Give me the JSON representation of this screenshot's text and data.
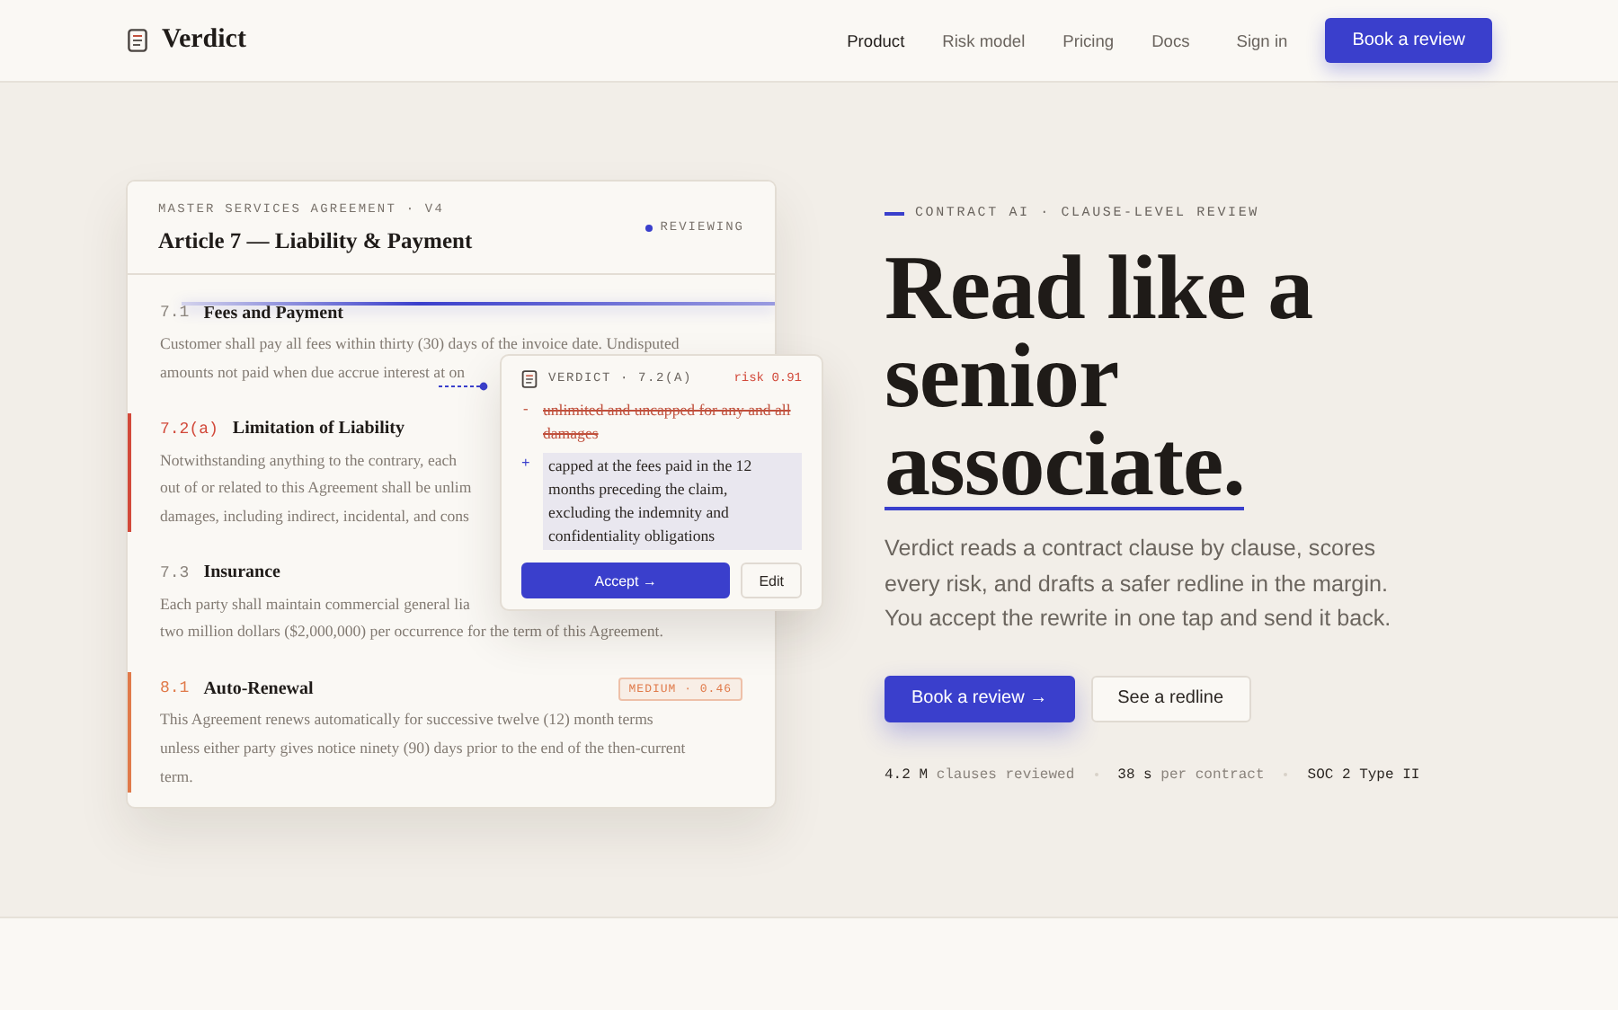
{
  "header": {
    "brand": "Verdict",
    "nav": [
      {
        "label": "Product",
        "selected": true
      },
      {
        "label": "Risk model",
        "selected": false
      },
      {
        "label": "Pricing",
        "selected": false
      },
      {
        "label": "Docs",
        "selected": false
      }
    ],
    "sign_in": "Sign in",
    "cta": "Book a review"
  },
  "contract": {
    "eyebrow": "MASTER SERVICES AGREEMENT · V4",
    "title": "Article 7 — Liability & Payment",
    "status": "REVIEWING",
    "clauses": [
      {
        "number": "7.1",
        "title": "Fees and Payment",
        "lines": [
          "Customer shall pay all fees within thirty (30) days of the invoice date. Undisputed",
          "amounts not paid when due accrue interest at on"
        ]
      },
      {
        "number": "7.2(a)",
        "title": "Limitation of Liability",
        "color": "#d2493a",
        "lines": [
          "Notwithstanding anything to the contrary, each",
          "out of or related to this Agreement shall be unlim",
          "damages, including indirect, incidental, and cons"
        ]
      },
      {
        "number": "7.3",
        "title": "Insurance",
        "lines": [
          "Each party shall maintain commercial general lia",
          "two million dollars ($2,000,000) per occurrence for the term of this Agreement."
        ]
      },
      {
        "number": "8.1",
        "title": "Auto-Renewal",
        "color": "#e07a4a",
        "badge": "MEDIUM · 0.46",
        "lines": [
          "This Agreement renews automatically for successive twelve (12) month terms",
          "unless either party gives notice ninety (90) days prior to the end of the then-current",
          "term."
        ]
      }
    ]
  },
  "suggestion": {
    "title": "VERDICT · 7.2(A)",
    "risk": "risk 0.91",
    "removed": {
      "marker": "-",
      "text": "unlimited and uncapped for any and all damages"
    },
    "added": {
      "marker": "+",
      "text": "capped at the fees paid in the 12 months preceding the claim, excluding the indemnity and confidentiality obligations"
    },
    "buttons": [
      {
        "label": "Accept →",
        "kind": "primary"
      },
      {
        "label": "Edit",
        "kind": "secondary"
      }
    ]
  },
  "hero": {
    "eyebrow": "CONTRACT AI · CLAUSE-LEVEL REVIEW",
    "heading": "Read like a senior",
    "heading_emphasis": "associate.",
    "body": "Verdict reads a contract clause by clause, scores every risk, and drafts a safer redline in the margin. You accept the rewrite in one tap and send it back.",
    "buttons": [
      {
        "label": "Book a review →",
        "kind": "primary"
      },
      {
        "label": "See a redline",
        "kind": "secondary"
      }
    ],
    "stats": [
      {
        "value": "4.2 M",
        "label": "clauses reviewed"
      },
      {
        "value": "38 s",
        "label": "per contract"
      },
      {
        "value": "SOC 2 Type II"
      }
    ]
  }
}
